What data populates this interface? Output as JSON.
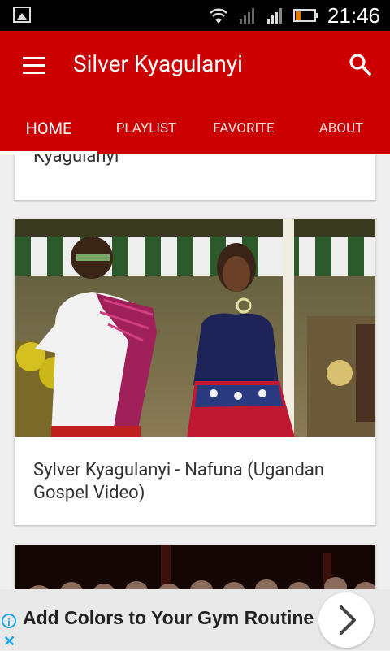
{
  "status_bar": {
    "time": "21:46"
  },
  "app_bar": {
    "title": "Silver Kyagulanyi"
  },
  "tabs": [
    {
      "label": "HOME"
    },
    {
      "label": "PLAYLIST"
    },
    {
      "label": "FAVORITE"
    },
    {
      "label": "ABOUT"
    }
  ],
  "videos": [
    {
      "title": "Kyagulanyi"
    },
    {
      "title": "Sylver Kyagulanyi - Nafuna (Ugandan Gospel Video)"
    },
    {
      "title": ""
    }
  ],
  "ad": {
    "text": "Add Colors to Your Gym Routine",
    "info_symbol": "i",
    "close_symbol": "✕"
  },
  "colors": {
    "primary": "#cc0000",
    "ad_accent": "#1ba6e0"
  }
}
